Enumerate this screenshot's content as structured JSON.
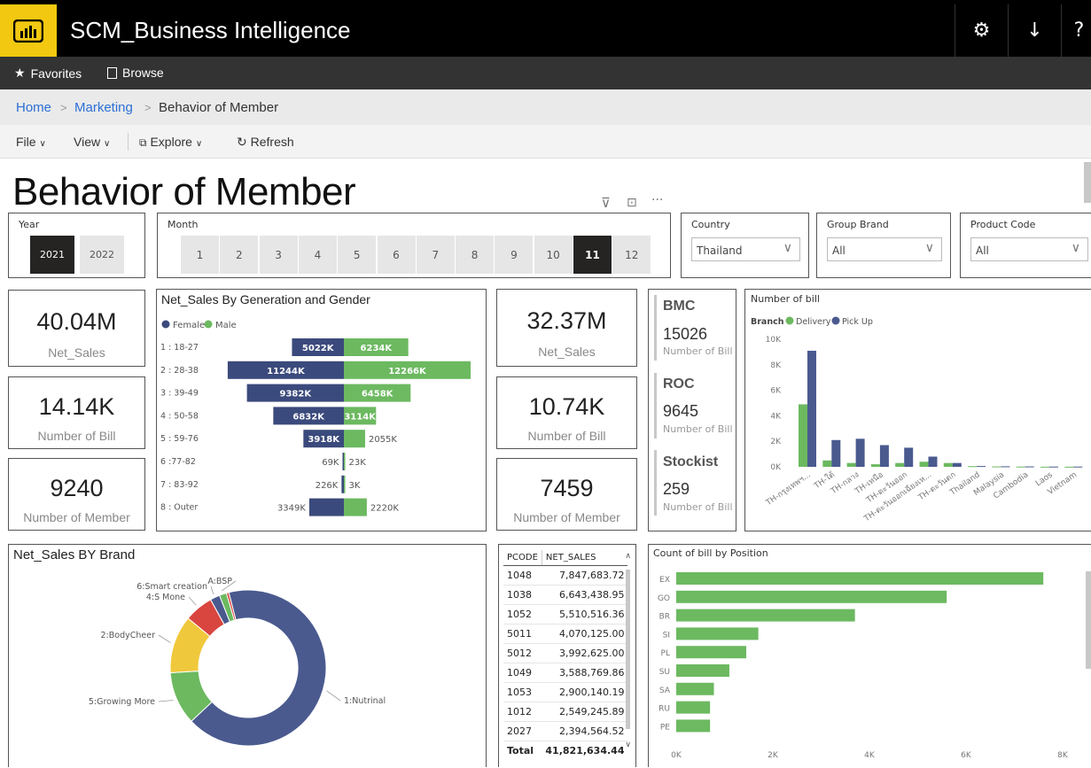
{
  "app": {
    "title": "SCM_Business Intelligence"
  },
  "nav": {
    "favorites": "Favorites",
    "browse": "Browse"
  },
  "breadcrumb": {
    "home": "Home",
    "marketing": "Marketing",
    "current": "Behavior of Member"
  },
  "toolbar": {
    "file": "File",
    "view": "View",
    "explore": "Explore",
    "refresh": "Refresh"
  },
  "page": {
    "title": "Behavior of Member"
  },
  "slicers": {
    "year": {
      "label": "Year",
      "options": [
        "2021",
        "2022"
      ],
      "selected": "2021"
    },
    "month": {
      "label": "Month",
      "options": [
        "1",
        "2",
        "3",
        "4",
        "5",
        "6",
        "7",
        "8",
        "9",
        "10",
        "11",
        "12"
      ],
      "selected": "11"
    },
    "country": {
      "label": "Country",
      "value": "Thailand"
    },
    "group_brand": {
      "label": "Group Brand",
      "value": "All"
    },
    "product_code": {
      "label": "Product Code",
      "value": "All"
    }
  },
  "cards_left": [
    {
      "value": "40.04M",
      "label": "Net_Sales"
    },
    {
      "value": "14.14K",
      "label": "Number of Bill"
    },
    {
      "value": "9240",
      "label": "Number of Member"
    }
  ],
  "cards_mid": [
    {
      "value": "32.37M",
      "label": "Net_Sales"
    },
    {
      "value": "10.74K",
      "label": "Number of Bill"
    },
    {
      "value": "7459",
      "label": "Number of Member"
    }
  ],
  "kpis": [
    {
      "name": "BMC",
      "value": "15026",
      "label": "Number of Bill"
    },
    {
      "name": "ROC",
      "value": "9645",
      "label": "Number of Bill"
    },
    {
      "name": "Stockist",
      "value": "259",
      "label": "Number of Bill"
    }
  ],
  "colors": {
    "female": "#3b4a7c",
    "male": "#6cb960",
    "navy": "#4a5a8f",
    "green": "#6cb960",
    "yellow": "#f0c83c",
    "red": "#d9453f",
    "selected": "#252423"
  },
  "chart_data": [
    {
      "type": "bar",
      "title": "Net_Sales By Generation and Gender",
      "legend": [
        "Female",
        "Male"
      ],
      "categories": [
        "1 : 18-27",
        "2 : 28-38",
        "3 : 39-49",
        "4 : 50-58",
        "5 : 59-76",
        "6 :77-82",
        "7 : 83-92",
        "8 : Outer"
      ],
      "series": [
        {
          "name": "Female",
          "values": [
            5022,
            11244,
            9382,
            6832,
            3918,
            69,
            226,
            3349
          ],
          "labels": [
            "5022K",
            "11244K",
            "9382K",
            "6832K",
            "3918K",
            "69K",
            "226K",
            "3349K"
          ]
        },
        {
          "name": "Male",
          "values": [
            6234,
            12266,
            6458,
            3114,
            2055,
            23,
            3,
            2220
          ],
          "labels": [
            "6234K",
            "12266K",
            "6458K",
            "3114K",
            "2055K",
            "23K",
            "3K",
            "2220K"
          ]
        }
      ]
    },
    {
      "type": "bar",
      "title": "Number of bill",
      "legend_title": "Branch",
      "legend": [
        "Delivery",
        "Pick Up"
      ],
      "categories": [
        "TH-กรุงเทพฯ...",
        "TH-ใต้",
        "TH-กลาง",
        "TH-เหนือ",
        "TH-ตะวันออก",
        "TH-ตะวันออกเฉียงเห...",
        "TH-ตะวันตก",
        "Thailand",
        "Malaysia",
        "Cambodia",
        "Laos",
        "Vietnam"
      ],
      "series": [
        {
          "name": "Delivery",
          "values": [
            4900,
            500,
            300,
            200,
            300,
            400,
            300,
            50,
            30,
            20,
            10,
            10
          ]
        },
        {
          "name": "Pick Up",
          "values": [
            9100,
            2100,
            2200,
            1700,
            1500,
            800,
            300,
            60,
            40,
            30,
            20,
            20
          ]
        }
      ],
      "yticks": [
        "0K",
        "2K",
        "4K",
        "6K",
        "8K",
        "10K"
      ],
      "ylim": [
        0,
        10000
      ]
    },
    {
      "type": "pie",
      "title": "Net_Sales BY Brand",
      "slices": [
        {
          "label": "1:Nutrinal",
          "value": 67,
          "color": "#4a5a8f"
        },
        {
          "label": "5:Growing More",
          "value": 11,
          "color": "#6cb960"
        },
        {
          "label": "2:BodyCheer",
          "value": 12,
          "color": "#f0c83c"
        },
        {
          "label": "4:S Mone",
          "value": 6,
          "color": "#d9453f"
        },
        {
          "label": "6:Smart creation",
          "value": 2,
          "color": "#4a5a8f"
        },
        {
          "label": "A:BSP",
          "value": 1.5,
          "color": "#6cb960"
        },
        {
          "label": "",
          "value": 0.5,
          "color": "#d9453f"
        }
      ]
    },
    {
      "type": "table",
      "columns": [
        "PCODE",
        "NET_SALES"
      ],
      "rows": [
        [
          "1048",
          "7,847,683.72"
        ],
        [
          "1038",
          "6,643,438.95"
        ],
        [
          "1052",
          "5,510,516.36"
        ],
        [
          "5011",
          "4,070,125.00"
        ],
        [
          "5012",
          "3,992,625.00"
        ],
        [
          "1049",
          "3,588,769.86"
        ],
        [
          "1053",
          "2,900,140.19"
        ],
        [
          "1012",
          "2,549,245.89"
        ],
        [
          "2027",
          "2,394,564.52"
        ]
      ],
      "total": [
        "Total",
        "41,821,634.44"
      ]
    },
    {
      "type": "bar",
      "title": "Count of bill by Position",
      "categories": [
        "EX",
        "GO",
        "BR",
        "SI",
        "PL",
        "SU",
        "SA",
        "RU",
        "PE"
      ],
      "values": [
        7600,
        5600,
        3700,
        1700,
        1450,
        1100,
        780,
        700,
        700
      ],
      "xticks": [
        "0K",
        "2K",
        "4K",
        "6K",
        "8K"
      ],
      "xlim": [
        0,
        8000
      ]
    }
  ]
}
